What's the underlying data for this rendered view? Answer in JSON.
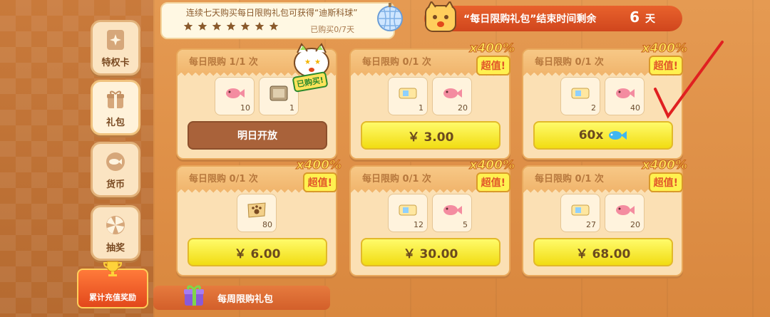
{
  "sidebar": {
    "tabs": [
      {
        "label": "特权卡",
        "icon": "privilege-card-icon"
      },
      {
        "label": "礼包",
        "icon": "gift-icon",
        "active": true
      },
      {
        "label": "货币",
        "icon": "fish-coin-icon"
      },
      {
        "label": "抽奖",
        "icon": "lottery-icon"
      }
    ],
    "reward_button": {
      "label": "累计充值奖励",
      "icon": "trophy-icon"
    }
  },
  "streak_banner": {
    "text": "连续七天购买每日限购礼包可获得“迪斯科球”",
    "stars_total": 7,
    "progress": "已购买0/7天",
    "reward_icon": "disco-ball-icon"
  },
  "countdown": {
    "text": "“每日限购礼包”结束时间剩余",
    "days": "6",
    "unit": "天"
  },
  "bought_sticker": "已购买!",
  "cards": [
    {
      "limit": "每日限购  1/1  次",
      "items": [
        {
          "icon": "fish-icon",
          "qty": "10"
        },
        {
          "icon": "catbox-icon",
          "qty": "1"
        }
      ],
      "price": "明日开放",
      "closed": true
    },
    {
      "limit": "每日限购  0/1  次",
      "badge_pct": "x400%",
      "badge_text": "超值!",
      "items": [
        {
          "icon": "ticket-icon",
          "qty": "1"
        },
        {
          "icon": "fish-icon",
          "qty": "20"
        }
      ],
      "price": "￥  3.00"
    },
    {
      "limit": "每日限购  0/1  次",
      "badge_pct": "x400%",
      "badge_text": "超值!",
      "items": [
        {
          "icon": "ticket-icon",
          "qty": "2"
        },
        {
          "icon": "fish-icon",
          "qty": "40"
        }
      ],
      "price": "60x",
      "price_icon": "blue-fish-icon"
    },
    {
      "limit": "每日限购  0/1  次",
      "badge_pct": "x400%",
      "badge_text": "超值!",
      "items": [
        {
          "icon": "paw-ticket-icon",
          "qty": "80"
        }
      ],
      "price": "￥  6.00"
    },
    {
      "limit": "每日限购  0/1  次",
      "badge_pct": "x400%",
      "badge_text": "超值!",
      "items": [
        {
          "icon": "ticket-icon",
          "qty": "12"
        },
        {
          "icon": "fish-icon",
          "qty": "5"
        }
      ],
      "price": "￥  30.00"
    },
    {
      "limit": "每日限购  0/1  次",
      "badge_pct": "x400%",
      "badge_text": "超值!",
      "items": [
        {
          "icon": "ticket-icon",
          "qty": "27"
        },
        {
          "icon": "fish-icon",
          "qty": "20"
        }
      ],
      "price": "￥  68.00"
    }
  ],
  "weekly": {
    "label": "每周限购礼包",
    "icon": "gift-box-icon"
  },
  "colors": {
    "accent": "#e8622c",
    "price_yellow": "#f1dc12",
    "card_bg": "#fbe0b4",
    "check_red": "#e02020"
  }
}
